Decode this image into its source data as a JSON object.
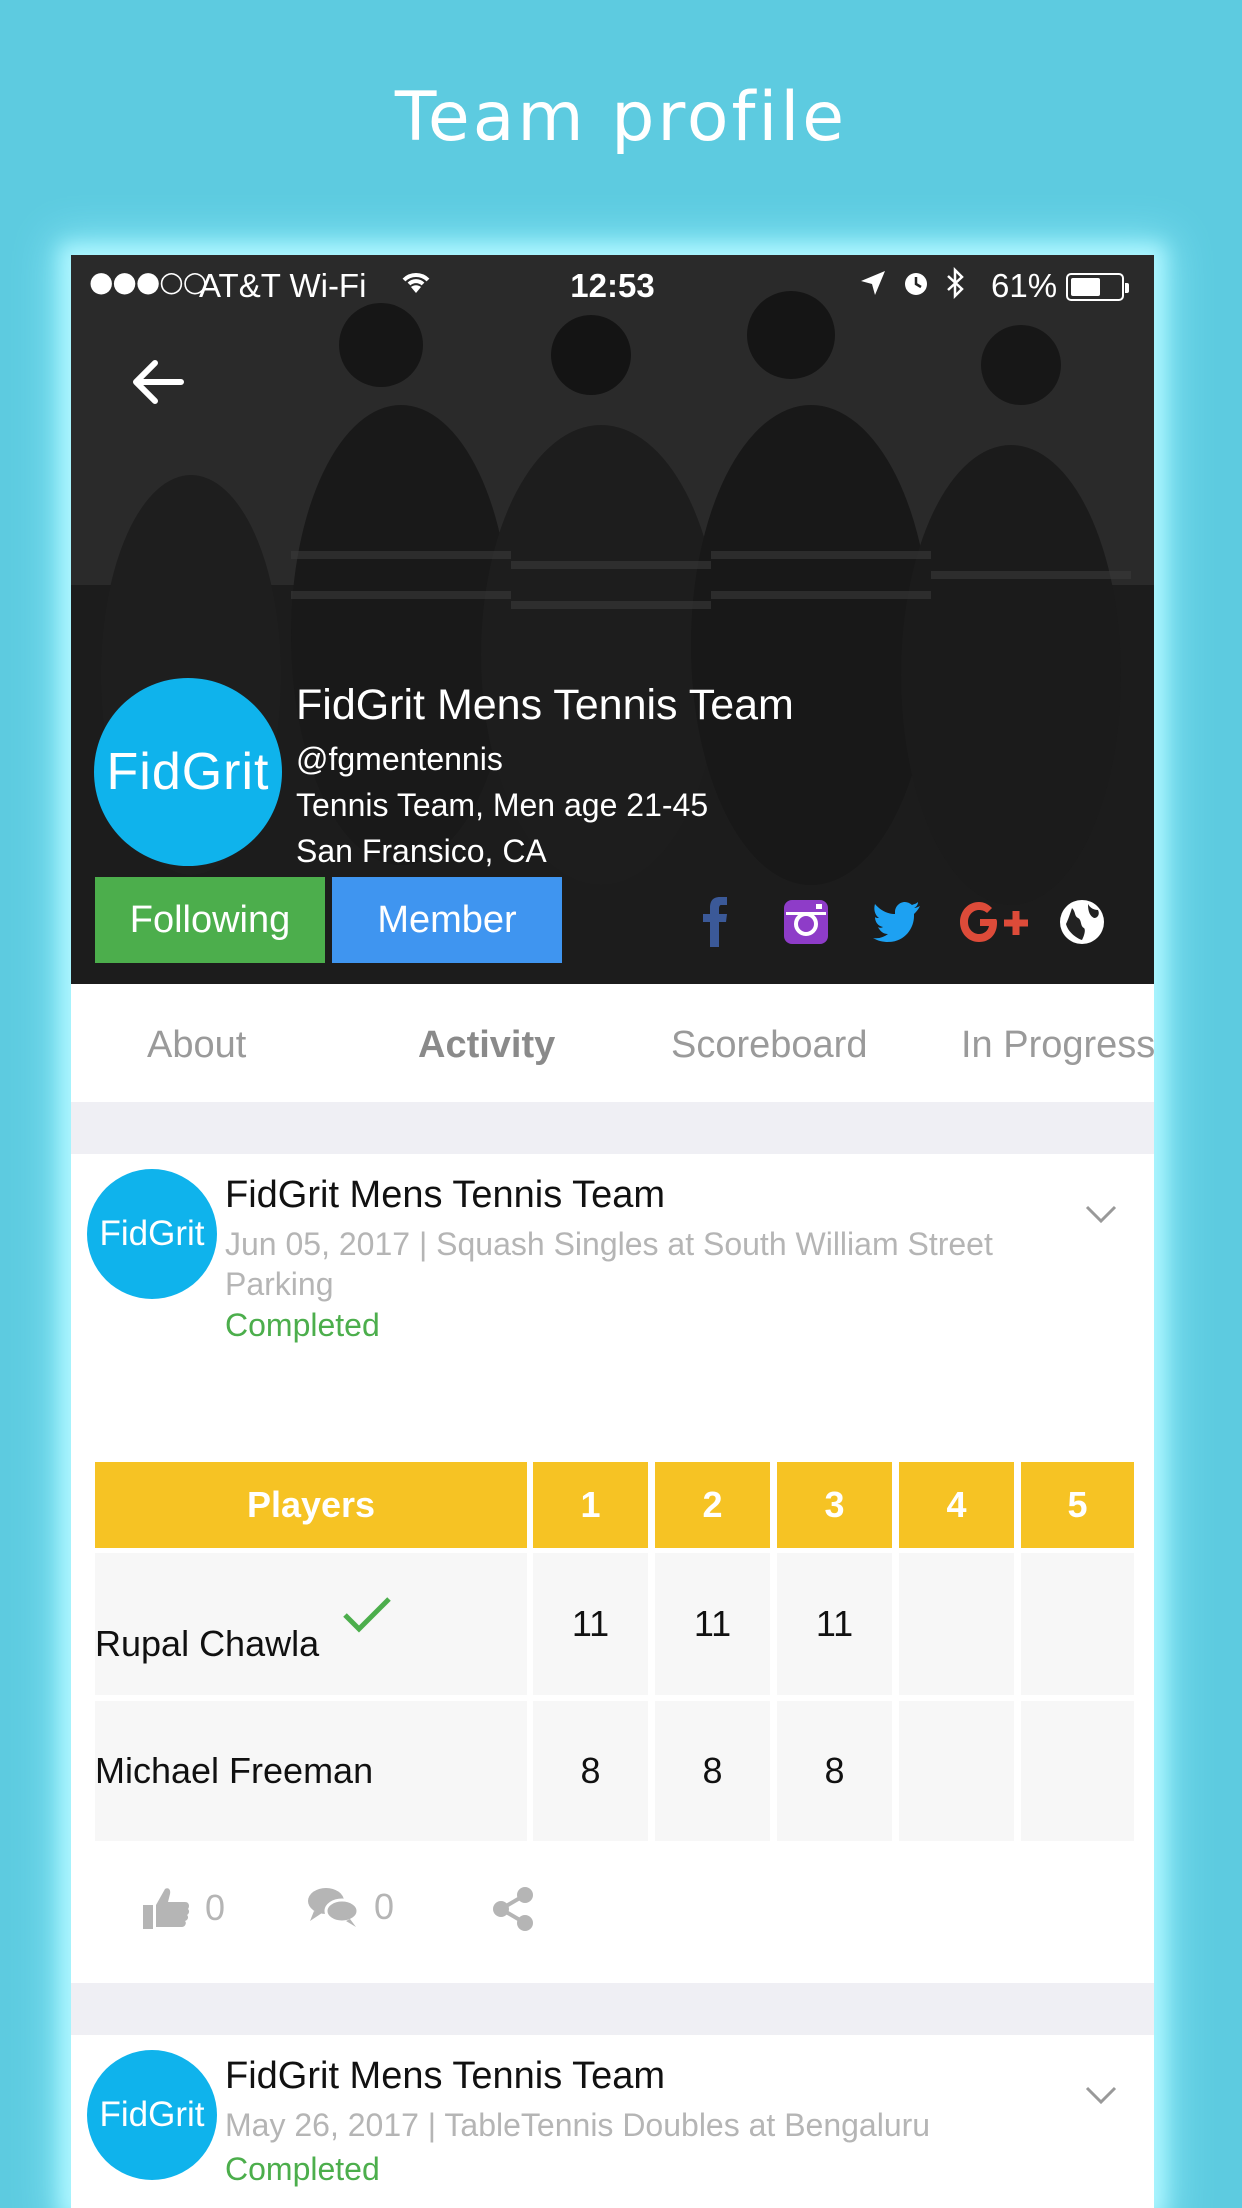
{
  "page": {
    "heading": "Team profile"
  },
  "status_bar": {
    "signal": "●●●○○",
    "carrier": "AT&T Wi-Fi",
    "time": "12:53",
    "battery": "61%",
    "battery_level": 0.61
  },
  "team": {
    "logo_text": "FidGrit",
    "name": "FidGrit Mens Tennis Team",
    "handle": "@fgmentennis",
    "description": "Tennis Team, Men age 21-45",
    "location": "San Fransico, CA",
    "following_label": "Following",
    "member_label": "Member",
    "social_icons": [
      "facebook-icon",
      "instagram-icon",
      "twitter-icon",
      "google-plus-icon",
      "globe-icon"
    ]
  },
  "tabs": [
    {
      "label": "About",
      "active": false
    },
    {
      "label": "Activity",
      "active": true
    },
    {
      "label": "Scoreboard",
      "active": false
    },
    {
      "label": "In Progress",
      "active": false
    }
  ],
  "posts": [
    {
      "avatar_text": "FidGrit",
      "title": "FidGrit Mens Tennis Team",
      "meta": "Jun 05, 2017 | Squash Singles at South William Street Parking",
      "status": "Completed",
      "table": {
        "headers": [
          "Players",
          "1",
          "2",
          "3",
          "4",
          "5"
        ],
        "rows": [
          {
            "player": "Rupal Chawla",
            "winner": true,
            "scores": [
              "11",
              "11",
              "11",
              "",
              ""
            ]
          },
          {
            "player": "Michael Freeman",
            "winner": false,
            "scores": [
              "8",
              "8",
              "8",
              "",
              ""
            ]
          }
        ]
      },
      "likes": "0",
      "comments": "0"
    },
    {
      "avatar_text": "FidGrit",
      "title": "FidGrit Mens Tennis Team",
      "meta": "May 26, 2017 | TableTennis Doubles at Bengaluru",
      "status": "Completed"
    }
  ],
  "colors": {
    "background": "#5dcbe0",
    "brand_blue": "#0fb3ec",
    "following_green": "#4cae4c",
    "member_blue": "#3f95f0",
    "table_header": "#f6c324",
    "completed_green": "#4cae4c",
    "facebook": "#3b5998",
    "instagram": "#8e3cc8",
    "twitter": "#1da1f2",
    "google_plus": "#dd4b39"
  }
}
